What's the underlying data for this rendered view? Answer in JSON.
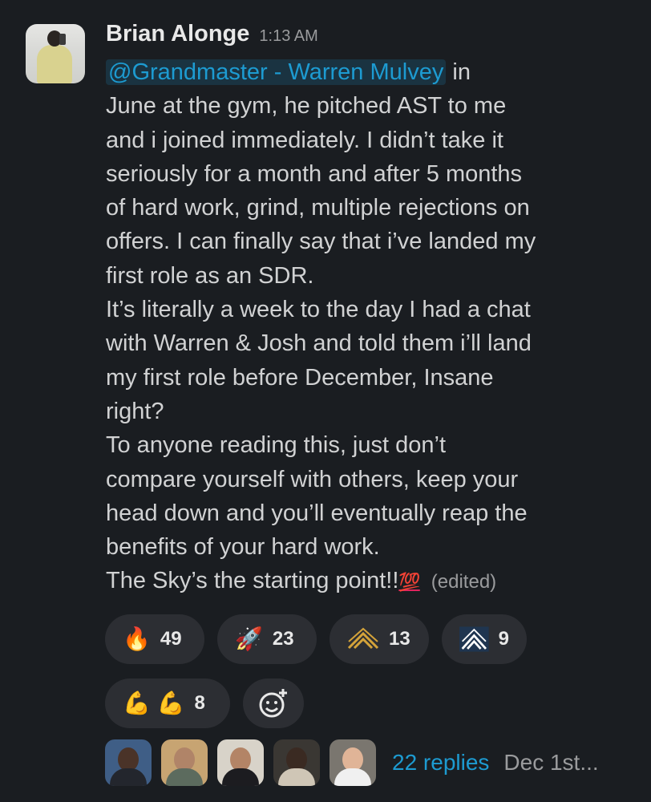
{
  "message": {
    "author": "Brian Alonge",
    "time": "1:13 AM",
    "mention": "@Grandmaster - Warren Mulvey",
    "line1_after": " in",
    "lines": [
      "June at the gym, he pitched AST to me",
      "and i joined immediately. I didn’t take it",
      "seriously for a month and after 5 months",
      "of hard work, grind, multiple rejections on",
      "offers. I can finally say that i’ve landed my",
      "first role as an SDR.",
      "It’s literally a week to the day I had a chat",
      "with Warren & Josh and told them i’ll land",
      "my first role before December, Insane",
      "right?",
      "To anyone reading this, just don’t",
      "compare yourself with others, keep your",
      "head down and you’ll eventually reap the",
      "benefits of your hard work."
    ],
    "last_line": "The Sky’s the starting point!!",
    "last_emoji": "💯",
    "edited": "(edited)"
  },
  "reactions": [
    {
      "emoji": "🔥",
      "count": "49"
    },
    {
      "emoji": "🚀",
      "count": "23"
    },
    {
      "emoji": "ast-logo-gold",
      "count": "13"
    },
    {
      "emoji": "ast-logo-blue",
      "count": "9"
    },
    {
      "emoji": "💪 💪",
      "count": "8"
    }
  ],
  "thread": {
    "replies": "22 replies",
    "last_reply": "Dec 1st..."
  },
  "colors": {
    "background": "#1a1d21",
    "link": "#1d9bd1",
    "pill": "#2c2e33",
    "gold_logo": "#d4a33a",
    "blue_logo_bg": "#1f3550"
  }
}
